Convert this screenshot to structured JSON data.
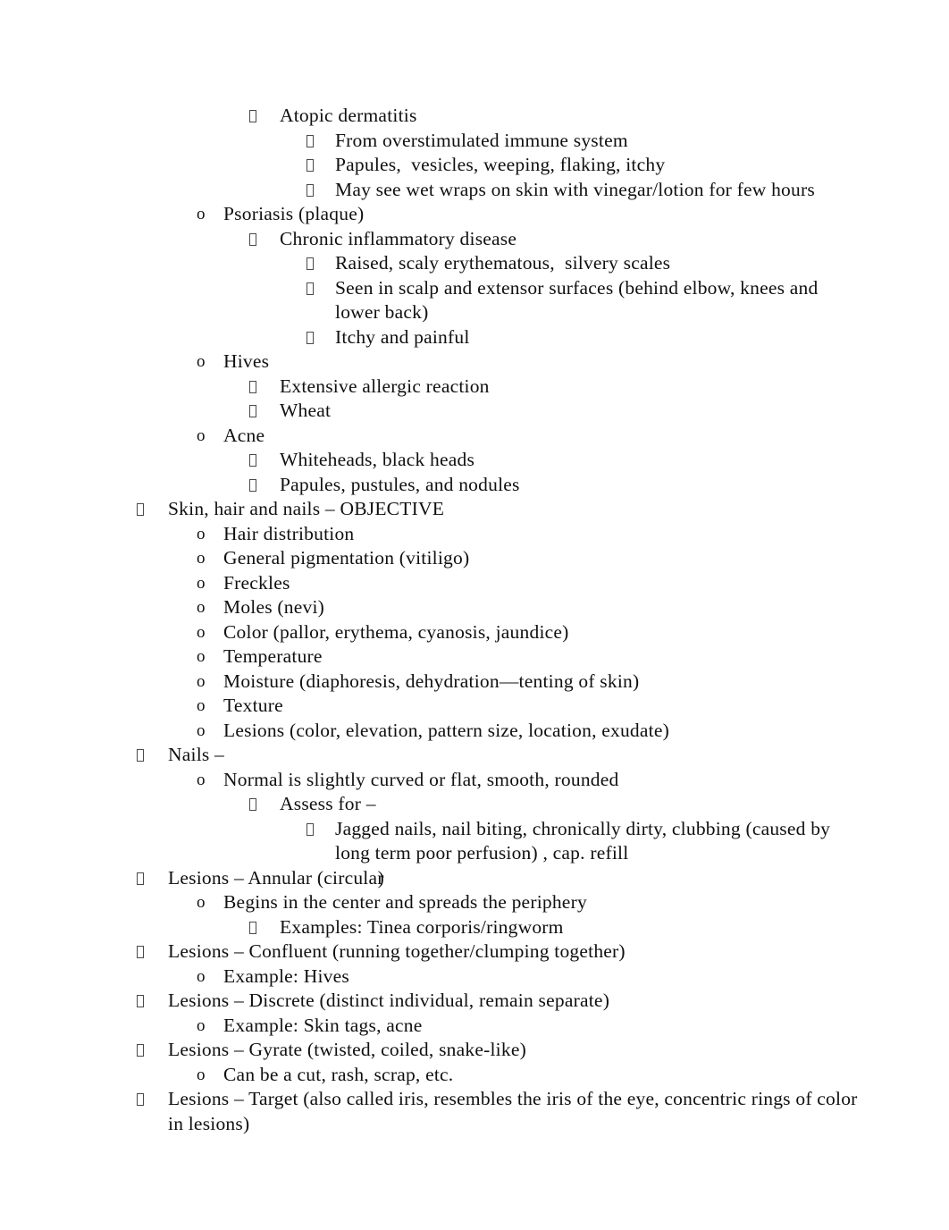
{
  "document": {
    "background_color": "#ffffff",
    "text_color": "#101010",
    "highlight_color": "#e2e0e0",
    "bullet_glyph": "missing-glyph-box",
    "outline": [
      {
        "level": 3,
        "marker": "box",
        "text": "Atopic dermatitis"
      },
      {
        "level": 4,
        "marker": "box",
        "text": "From overstimulated immune system"
      },
      {
        "level": 4,
        "marker": "box",
        "text": "Papules,  vesicles, weeping, flaking, itchy"
      },
      {
        "level": 4,
        "marker": "box",
        "text": "May see wet wraps on skin with vinegar/lotion for few hours"
      },
      {
        "level": 2,
        "marker": "o",
        "text": "Psoriasis (plaque)"
      },
      {
        "level": 3,
        "marker": "box",
        "text": "Chronic inflammatory disease"
      },
      {
        "level": 4,
        "marker": "box",
        "text": "Raised, scaly erythematous,  silvery scales"
      },
      {
        "level": 4,
        "marker": "box",
        "text": "Seen in scalp and extensor surfaces (behind elbow, knees and lower back)"
      },
      {
        "level": 4,
        "marker": "box",
        "text": "Itchy and painful"
      },
      {
        "level": 2,
        "marker": "o",
        "text": "Hives"
      },
      {
        "level": 3,
        "marker": "box",
        "text": "Extensive allergic reaction"
      },
      {
        "level": 3,
        "marker": "box",
        "text": "Wheat"
      },
      {
        "level": 2,
        "marker": "o",
        "text": "Acne"
      },
      {
        "level": 3,
        "marker": "box",
        "text": "Whiteheads, black heads"
      },
      {
        "level": 3,
        "marker": "box",
        "text": "Papules, pustules, and nodules"
      },
      {
        "level": 1,
        "marker": "box",
        "text": "Skin, hair and nails – OBJECTIVE",
        "highlight": true
      },
      {
        "level": 2,
        "marker": "o",
        "text": "Hair distribution"
      },
      {
        "level": 2,
        "marker": "o",
        "text": "General pigmentation (vitiligo)"
      },
      {
        "level": 2,
        "marker": "o",
        "text": "Freckles"
      },
      {
        "level": 2,
        "marker": "o",
        "text": "Moles (nevi)"
      },
      {
        "level": 2,
        "marker": "o",
        "text": "Color (pallor, erythema, cyanosis, jaundice)"
      },
      {
        "level": 2,
        "marker": "o",
        "text": "Temperature"
      },
      {
        "level": 2,
        "marker": "o",
        "text": "Moisture (diaphoresis, dehydration—tenting of skin)"
      },
      {
        "level": 2,
        "marker": "o",
        "text": "Texture"
      },
      {
        "level": 2,
        "marker": "o",
        "text": "Lesions (color, elevation, pattern size, location, exudate)"
      },
      {
        "level": 1,
        "marker": "box",
        "text": "Nails –"
      },
      {
        "level": 2,
        "marker": "o",
        "text": "Normal is slightly curved or flat, smooth, rounded"
      },
      {
        "level": 3,
        "marker": "box",
        "text": "Assess for –"
      },
      {
        "level": 4,
        "marker": "box",
        "text": "Jagged nails, nail biting, chronically dirty, clubbing (caused by long term poor perfusion) , cap. refill"
      },
      {
        "level": 1,
        "marker": "box",
        "text": "Lesions – Annular (circular)",
        "highlight": true,
        "kern_artifact": true
      },
      {
        "level": 2,
        "marker": "o",
        "text": "Begins in the center and spreads the periphery"
      },
      {
        "level": 3,
        "marker": "box",
        "text": "Examples: Tinea corporis/ringworm"
      },
      {
        "level": 1,
        "marker": "box",
        "text": "Lesions – Confluent (running together/clumping together)",
        "highlight": true
      },
      {
        "level": 2,
        "marker": "o",
        "text": "Example: Hives"
      },
      {
        "level": 1,
        "marker": "box",
        "text": "Lesions – Discrete (distinct individual, remain separate)",
        "highlight": true
      },
      {
        "level": 2,
        "marker": "o",
        "text": "Example: Skin tags, acne"
      },
      {
        "level": 1,
        "marker": "box",
        "text": "Lesions – Gyrate (twisted, coiled, snake-like)",
        "highlight": true
      },
      {
        "level": 2,
        "marker": "o",
        "text": "Can be a cut, rash, scrap, etc."
      },
      {
        "level": 1,
        "marker": "box",
        "text": "Lesions – Target (also called iris, resembles the iris of the eye, concentric rings of color in lesions)",
        "highlight": true
      }
    ]
  }
}
